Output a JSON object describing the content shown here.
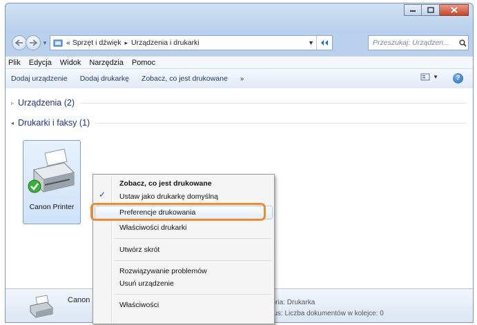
{
  "address": {
    "crumbs": [
      "Sprzęt i dźwięk",
      "Urządzenia i drukarki"
    ],
    "overflow": "«",
    "separator": "▸"
  },
  "search": {
    "placeholder": "Przeszukaj: Urządzen..."
  },
  "menubar": [
    "Plik",
    "Edycja",
    "Widok",
    "Narzędzia",
    "Pomoc"
  ],
  "commandbar": {
    "items": [
      "Dodaj urządzenie",
      "Dodaj drukarkę",
      "Zobacz, co jest drukowane"
    ],
    "more": "»",
    "help": "?"
  },
  "groups": {
    "devices": {
      "arrow": "▹",
      "title": "Urządzenia (2)"
    },
    "printers": {
      "arrow": "◂",
      "title": "Drukarki i faksy (1)"
    }
  },
  "printer": {
    "label": "Canon Printer"
  },
  "details": {
    "name": "Canon",
    "category": "goria: Drukarka",
    "status": "atus: Liczba dokumentów w kolejce: 0"
  },
  "context_menu": {
    "items": [
      "Zobacz, co jest drukowane",
      "Ustaw jako drukarkę domyślną",
      "Preferencje drukowania",
      "Właściwości drukarki",
      "Utwórz skrót",
      "Rozwiązywanie problemów",
      "Usuń urządzenie",
      "Właściwości"
    ],
    "check": "✓"
  },
  "colors": {
    "highlight_frame": "#f18a2e",
    "title_bar": "#b9d1ec",
    "group_title": "#1e3287"
  }
}
